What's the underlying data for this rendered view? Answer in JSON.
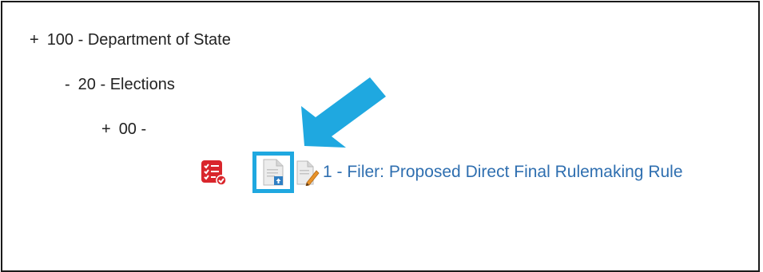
{
  "tree": {
    "level1": {
      "toggle": "+",
      "label": "100 - Department of State"
    },
    "level2": {
      "toggle": "-",
      "label": "20 - Elections"
    },
    "level3": {
      "toggle": "+",
      "label": "00 -"
    },
    "document": {
      "link_text": "1 - Filer: Proposed Direct Final Rulemaking Rule"
    }
  },
  "icons": {
    "task": "task-checklist-icon",
    "document": "document-upload-icon",
    "edit": "document-edit-icon",
    "annotation": "pointer-arrow-icon"
  },
  "colors": {
    "link": "#2f6fb0",
    "highlight": "#1fa8e0",
    "task_icon": "#d9262c"
  }
}
